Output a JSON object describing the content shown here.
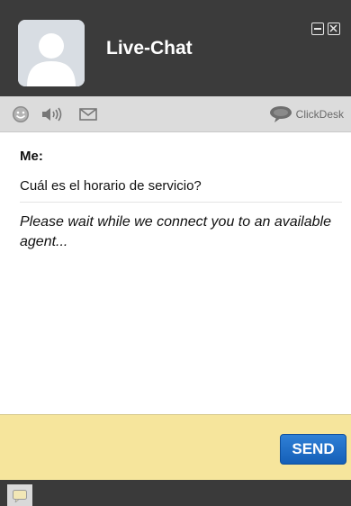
{
  "header": {
    "title": "Live-Chat",
    "avatar_icon": "user-silhouette-icon",
    "minimize_icon": "minimize-icon",
    "close_icon": "close-icon"
  },
  "toolbar": {
    "icons": [
      "emoji-icon",
      "sound-icon",
      "mail-icon"
    ],
    "brand": "ClickDesk",
    "brand_icon": "chat-bubble-icon"
  },
  "messages": {
    "sender": "Me:",
    "text": "Cuál es el horario de servicio?",
    "system": "Please wait while we connect you to an available agent..."
  },
  "input": {
    "placeholder": ""
  },
  "send_button": {
    "label": "SEND",
    "color": "#1a6cc8"
  },
  "footer": {
    "tab_icon": "chat-bubble-icon"
  },
  "colors": {
    "header_bg": "#3b3b3b",
    "toolbar_bg": "#dcdcdc",
    "input_bg": "#f6e59c"
  }
}
